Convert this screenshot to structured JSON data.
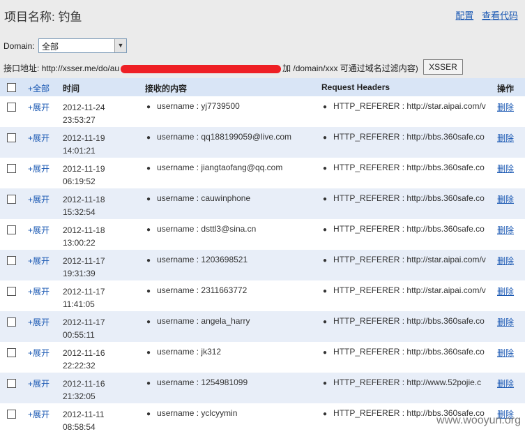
{
  "header": {
    "title": "项目名称: 钓鱼",
    "config_link": "配置",
    "view_code_link": "查看代码"
  },
  "filters": {
    "domain_label": "Domain:",
    "domain_value": "全部",
    "api_label": "接口地址:",
    "api_url_visible": "http://xsser.me/do/au",
    "api_hint": "加 /domain/xxx 可通过域名过滤内容)",
    "xsser_button": "XSSER"
  },
  "table": {
    "columns": {
      "expand_all": "+全部",
      "time": "时间",
      "content": "接收的内容",
      "headers": "Request Headers",
      "action": "操作"
    },
    "expand_label": "+展开",
    "delete_label": "删除",
    "rows": [
      {
        "date": "2012-11-24",
        "time": "23:53:27",
        "content": "username : yj7739500",
        "header": "HTTP_REFERER : http://star.aipai.com/v"
      },
      {
        "date": "2012-11-19",
        "time": "14:01:21",
        "content": "username : qq188199059@live.com",
        "header": "HTTP_REFERER : http://bbs.360safe.co"
      },
      {
        "date": "2012-11-19",
        "time": "06:19:52",
        "content": "username : jiangtaofang@qq.com",
        "header": "HTTP_REFERER : http://bbs.360safe.co"
      },
      {
        "date": "2012-11-18",
        "time": "15:32:54",
        "content": "username : cauwinphone",
        "header": "HTTP_REFERER : http://bbs.360safe.co"
      },
      {
        "date": "2012-11-18",
        "time": "13:00:22",
        "content": "username : dsttl3@sina.cn",
        "header": "HTTP_REFERER : http://bbs.360safe.co"
      },
      {
        "date": "2012-11-17",
        "time": "19:31:39",
        "content": "username : 1203698521",
        "header": "HTTP_REFERER : http://star.aipai.com/v"
      },
      {
        "date": "2012-11-17",
        "time": "11:41:05",
        "content": "username : 2311663772",
        "header": "HTTP_REFERER : http://star.aipai.com/v"
      },
      {
        "date": "2012-11-17",
        "time": "00:55:11",
        "content": "username : angela_harry",
        "header": "HTTP_REFERER : http://bbs.360safe.co"
      },
      {
        "date": "2012-11-16",
        "time": "22:22:32",
        "content": "username : jk312",
        "header": "HTTP_REFERER : http://bbs.360safe.co"
      },
      {
        "date": "2012-11-16",
        "time": "21:32:05",
        "content": "username : 1254981099",
        "header": "HTTP_REFERER : http://www.52pojie.c"
      },
      {
        "date": "2012-11-11",
        "time": "08:58:54",
        "content": "username : yclcyymin",
        "header": "HTTP_REFERER : http://bbs.360safe.co"
      }
    ]
  },
  "watermark": "www.wooyun.org"
}
